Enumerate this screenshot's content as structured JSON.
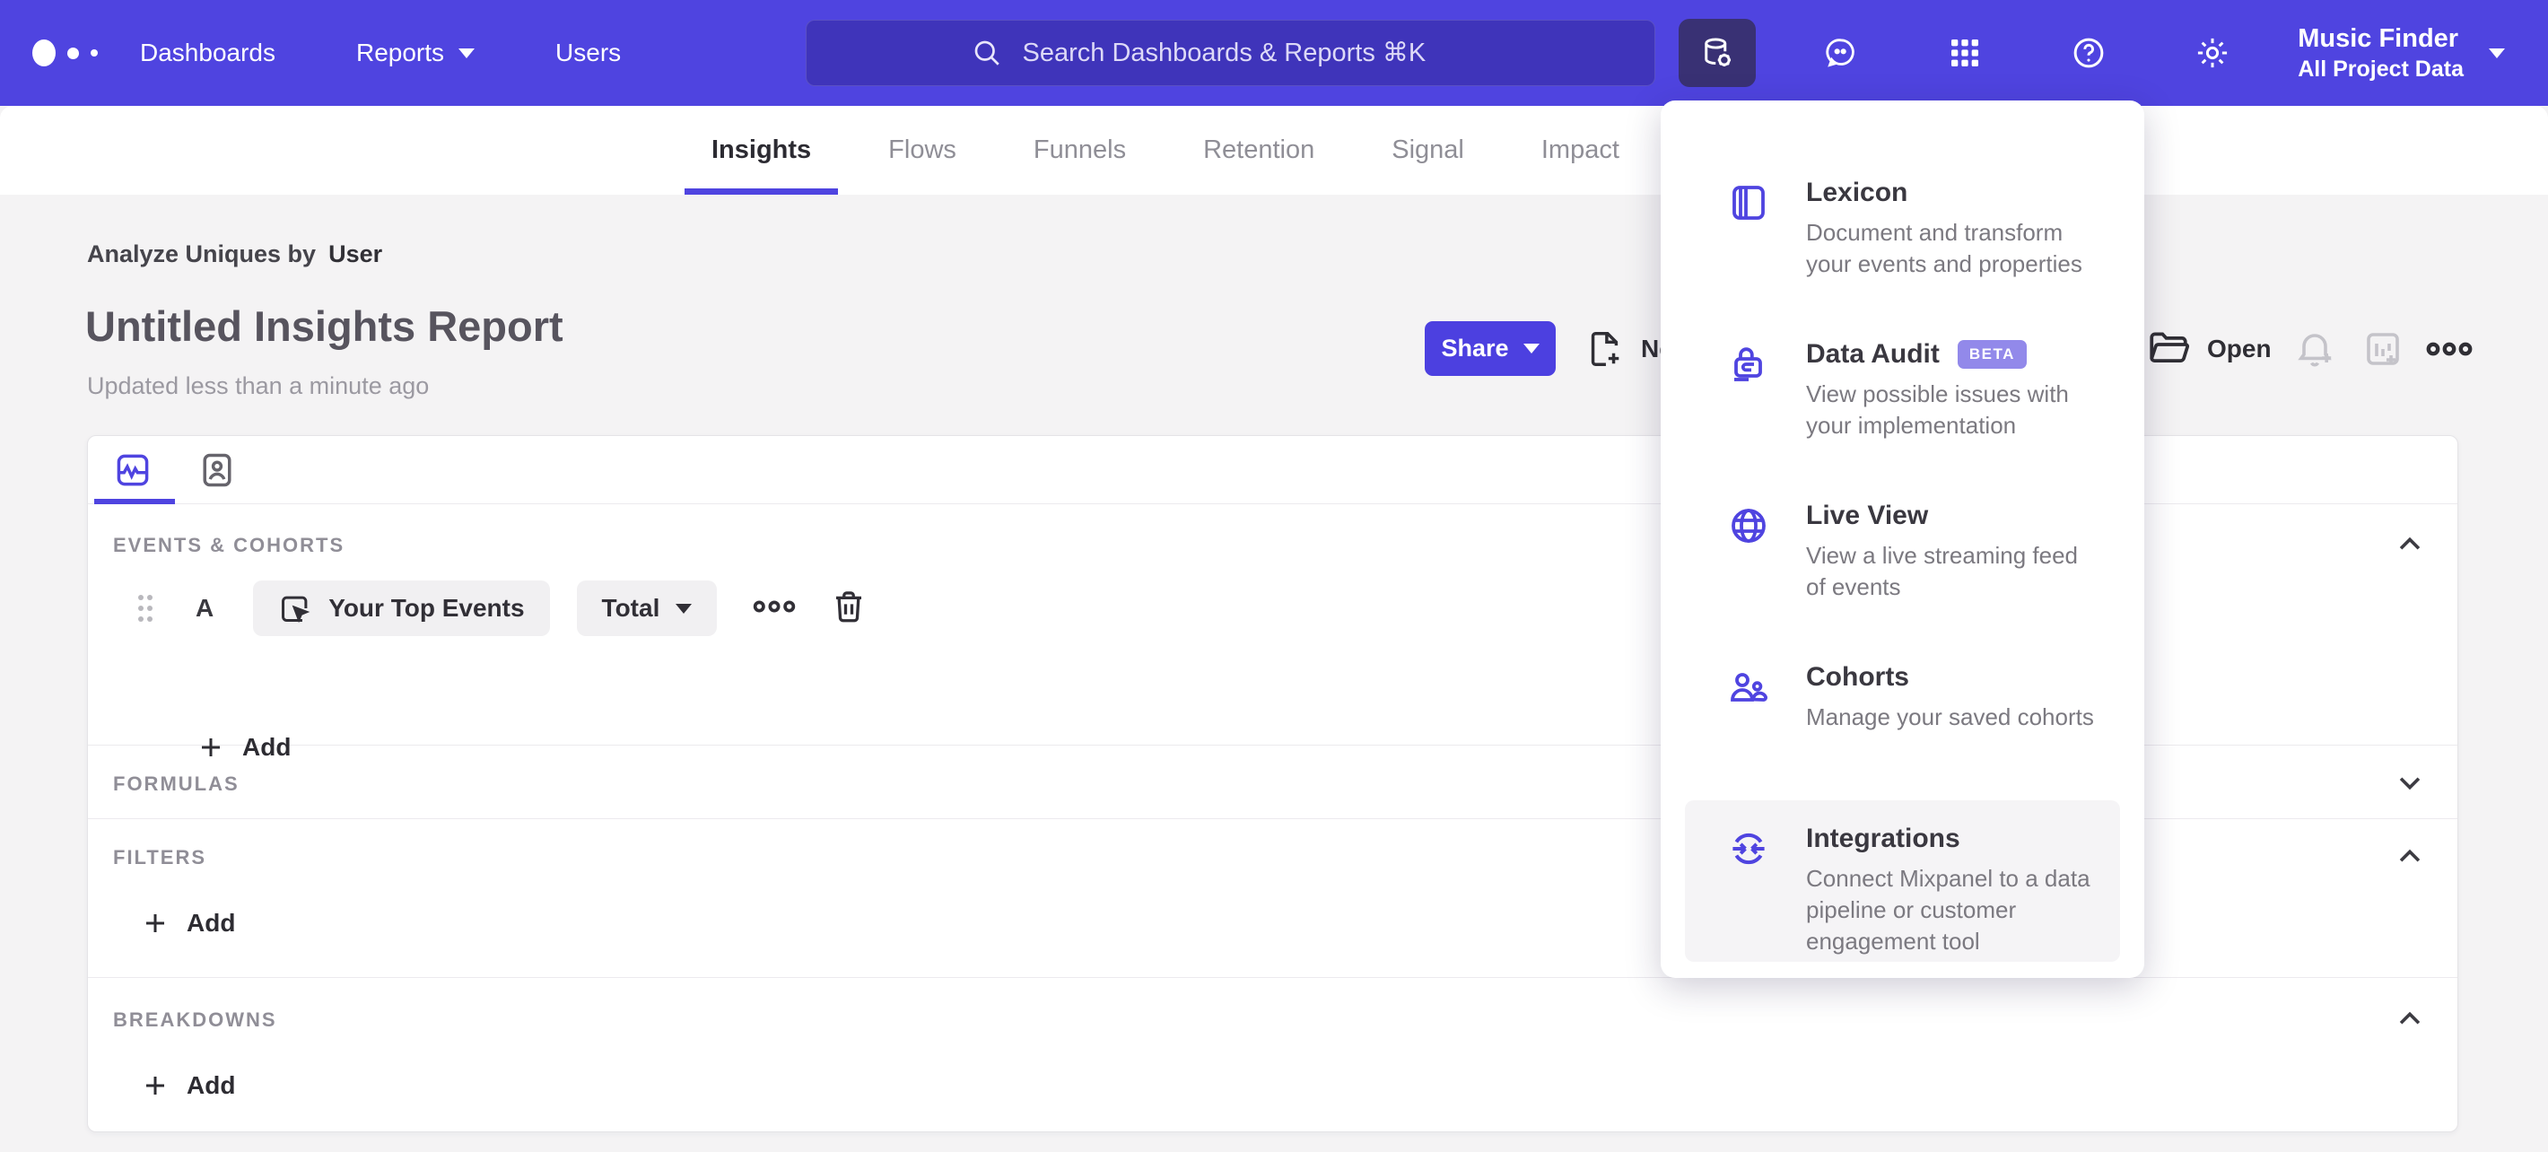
{
  "colors": {
    "brand": "#4f44e0",
    "nav_bg": "#4f44e0",
    "nav_active_icon_bg": "#393174",
    "share_button": "#4c40e0",
    "beta_badge": "#9289ea",
    "page_bg": "#f4f3f4"
  },
  "nav": {
    "logo_icon": "mixpanel-dots-logo",
    "items": [
      {
        "label": "Dashboards"
      },
      {
        "label": "Reports",
        "caret": true
      },
      {
        "label": "Users"
      }
    ],
    "search_placeholder": "Search Dashboards & Reports ⌘K",
    "right_icons": [
      "data-management-icon",
      "feedback-icon",
      "apps-grid-icon",
      "help-icon",
      "settings-icon"
    ],
    "project_name": "Music Finder",
    "project_scope": "All Project Data"
  },
  "tabs": [
    {
      "label": "Insights",
      "active": true
    },
    {
      "label": "Flows"
    },
    {
      "label": "Funnels"
    },
    {
      "label": "Retention"
    },
    {
      "label": "Signal"
    },
    {
      "label": "Impact"
    }
  ],
  "report": {
    "analyze_label": "Analyze Uniques by",
    "analyze_value": "User",
    "title": "Untitled Insights Report",
    "updated": "Updated less than a minute ago",
    "share_label": "Share",
    "new_label": "New",
    "open_label": "Open",
    "toolbar_icons": [
      "new-report-icon",
      "open-folder-icon",
      "bell-plus-icon",
      "board-plus-icon",
      "more-options-icon"
    ]
  },
  "builder": {
    "tab_icons": [
      "insights-chart-icon",
      "profiles-icon"
    ],
    "events": {
      "title": "EVENTS & COHORTS",
      "row": {
        "letter": "A",
        "event": "Your Top Events",
        "event_icon": "event-cursor-icon",
        "metric": "Total"
      },
      "add_label": "Add"
    },
    "formulas": {
      "title": "FORMULAS"
    },
    "filters": {
      "title": "FILTERS",
      "add_label": "Add"
    },
    "breakdowns": {
      "title": "BREAKDOWNS",
      "add_label": "Add"
    }
  },
  "dropdown": {
    "items": [
      {
        "icon": "lexicon-icon",
        "title": "Lexicon",
        "description": "Document and transform your events and properties"
      },
      {
        "icon": "data-audit-icon",
        "title": "Data Audit",
        "badge": "BETA",
        "description": "View possible issues with your implementation"
      },
      {
        "icon": "live-view-icon",
        "title": "Live View",
        "description": "View a live streaming feed of events"
      },
      {
        "icon": "cohorts-icon",
        "title": "Cohorts",
        "description": "Manage your saved cohorts"
      },
      {
        "icon": "integrations-icon",
        "title": "Integrations",
        "description": "Connect Mixpanel to a data pipeline or customer engagement tool",
        "highlighted": true
      }
    ]
  }
}
